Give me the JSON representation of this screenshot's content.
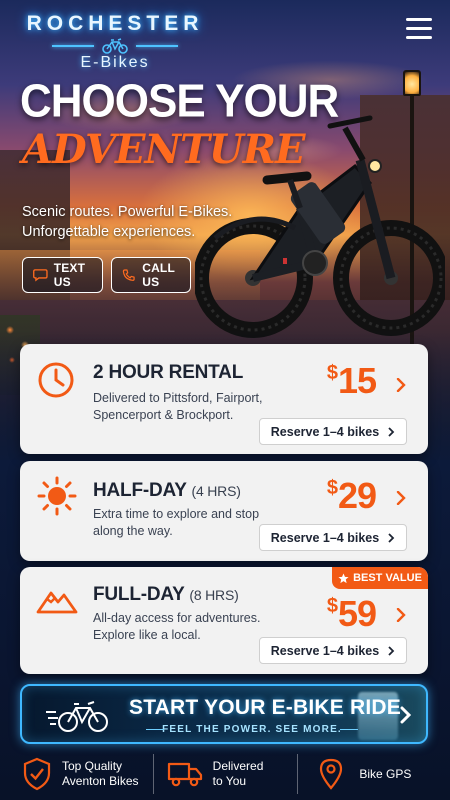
{
  "header": {
    "brand_top": "ROCHESTER",
    "brand_bottom": "E-Bikes",
    "menu_icon": "hamburger-menu-icon"
  },
  "hero": {
    "title": "CHOOSE YOUR",
    "script": "ADVENTURE",
    "subtitle": "Scenic routes. Powerful E-Bikes. Unforgettable experiences.",
    "text_us_label": "TEXT US",
    "call_us_label": "CALL US"
  },
  "rentals": [
    {
      "title": "2 HOUR RENTAL",
      "duration": "",
      "description": "Delivered to Pittsford, Fairport, Spencerport & Brockport.",
      "currency": "$",
      "price": "15",
      "reserve_label": "Reserve 1–4 bikes",
      "icon": "clock-icon"
    },
    {
      "title": "HALF-DAY",
      "duration": "(4 HRS)",
      "description": "Extra time to explore and stop along the way.",
      "currency": "$",
      "price": "29",
      "reserve_label": "Reserve 1–4 bikes",
      "icon": "sun-icon"
    },
    {
      "title": "FULL-DAY",
      "duration": "(8 HRS)",
      "description": "All-day access for adventures. Explore like a local.",
      "currency": "$",
      "price": "59",
      "reserve_label": "Reserve 1–4 bikes",
      "icon": "mountain-icon",
      "badge": "BEST VALUE"
    }
  ],
  "banner": {
    "title": "START YOUR E-BIKE RIDE",
    "subtitle": "FEEL THE POWER. SEE MORE."
  },
  "features": [
    {
      "label_line1": "Top Quality",
      "label_line2": "Aventon Bikes",
      "icon": "shield-check-icon"
    },
    {
      "label_line1": "Delivered",
      "label_line2": "to You",
      "icon": "truck-icon"
    },
    {
      "label_line1": "Bike GPS",
      "label_line2": "",
      "icon": "map-pin-icon"
    }
  ],
  "colors": {
    "accent": "#f25a15",
    "neon": "#3fb8ff",
    "navy": "#0c1a3a"
  }
}
